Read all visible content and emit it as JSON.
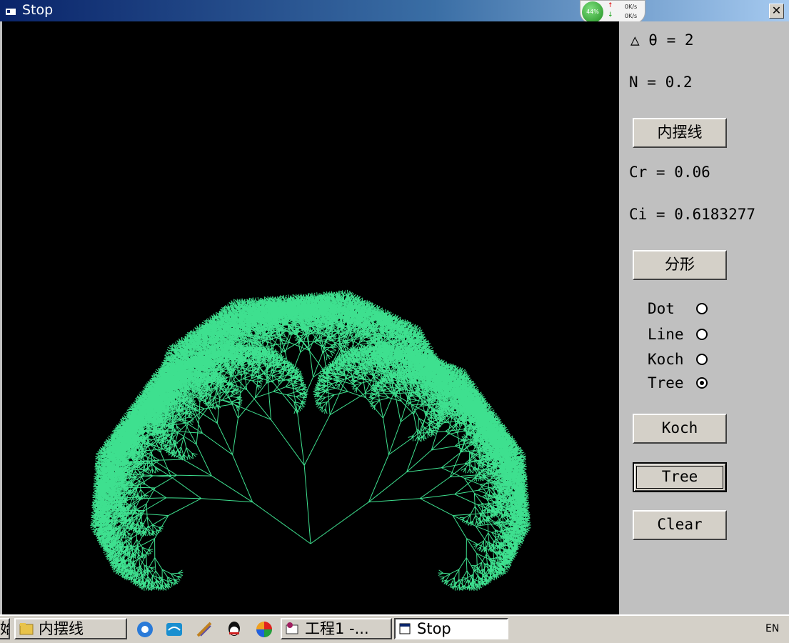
{
  "window": {
    "title": "Stop",
    "close_label": "✕"
  },
  "netmon": {
    "percent": "44%",
    "up": "0K/s",
    "down": "0K/s"
  },
  "panel": {
    "theta_label": "△ θ = 2",
    "n_label": "N = 0.2",
    "hypocycloid_button": "内摆线",
    "cr_label": "Cr = 0.06",
    "ci_label": "Ci = 0.6183277",
    "fractal_button": "分形",
    "radio_options": [
      {
        "label": "Dot",
        "selected": false
      },
      {
        "label": "Line",
        "selected": false
      },
      {
        "label": "Koch",
        "selected": false
      },
      {
        "label": "Tree",
        "selected": true
      }
    ],
    "koch_button": "Koch",
    "tree_button": "Tree",
    "clear_button": "Clear"
  },
  "canvas": {
    "background": "#000000",
    "stroke_color": "#3ee08f"
  },
  "taskbar": {
    "start_fragment": "始",
    "tasks": [
      {
        "label": "内摆线",
        "icon": "folder-icon"
      },
      {
        "label": "工程1 -...",
        "icon": "vb-project-icon"
      },
      {
        "label": "Stop",
        "icon": "form-window-icon"
      }
    ],
    "quick_launch": [
      "browser-icon",
      "ie-icon",
      "tools-icon",
      "qq-icon",
      "color-wheel-icon"
    ],
    "language": "EN"
  }
}
